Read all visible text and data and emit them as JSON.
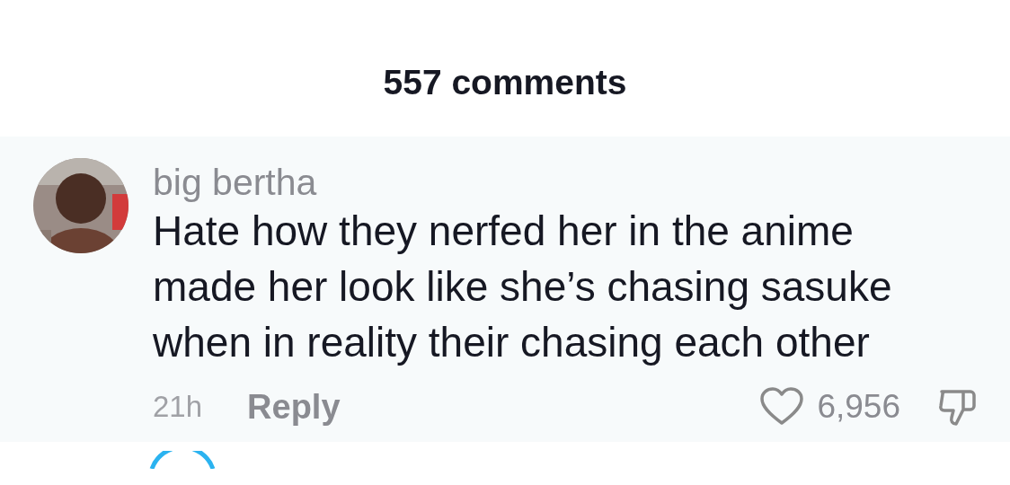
{
  "header": {
    "title": "557 comments"
  },
  "comments": [
    {
      "author": "big bertha",
      "text": "Hate how they nerfed her in the anime made her look like she’s chasing sasuke when in reality their chasing each other",
      "time": "21h",
      "reply_label": "Reply",
      "likes": "6,956",
      "liked": false
    }
  ]
}
